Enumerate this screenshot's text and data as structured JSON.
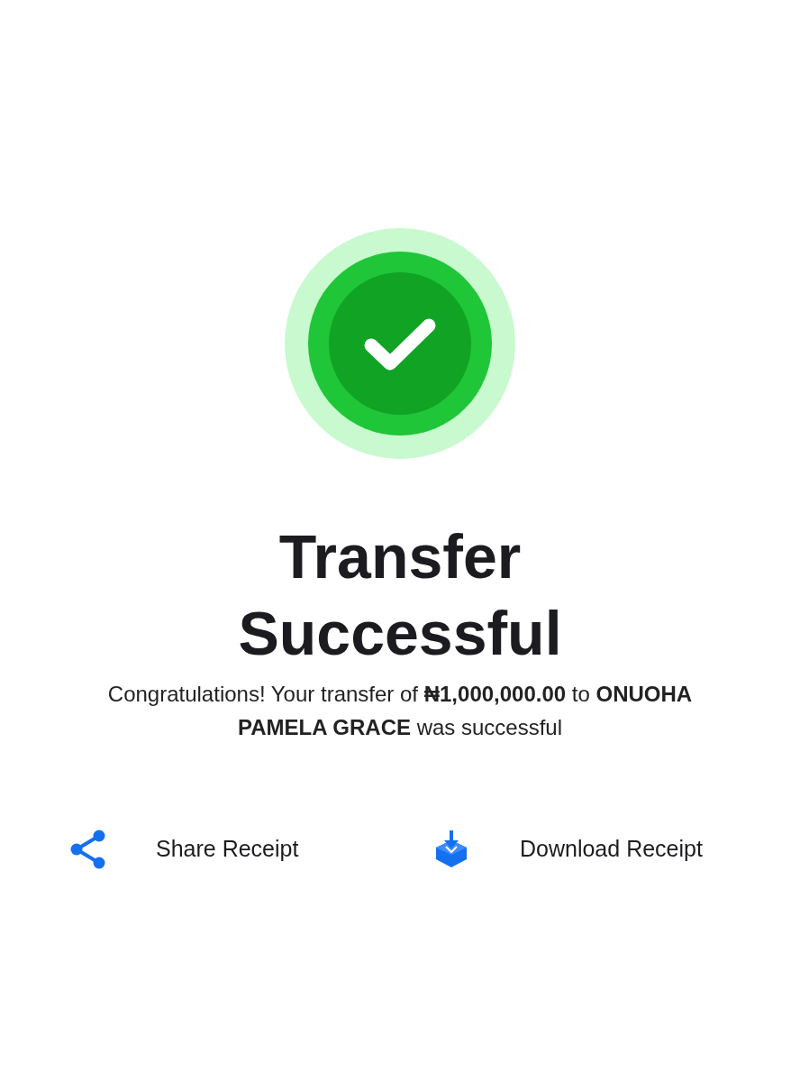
{
  "title": "Transfer Successful",
  "message": "Congratulations! Your transfer of **₦1,000,000.00** to **ONUOHA PAMELA GRACE** was successful",
  "actions": [
    {
      "kind": "share",
      "label": "Share Receipt"
    },
    {
      "kind": "download",
      "label": "Download Receipt"
    }
  ]
}
